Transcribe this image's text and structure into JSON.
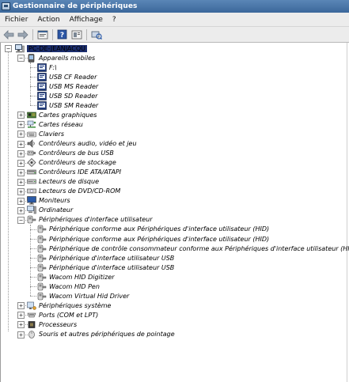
{
  "window": {
    "title": "Gestionnaire de périphériques"
  },
  "menu": [
    "Fichier",
    "Action",
    "Affichage",
    "?"
  ],
  "toolbar": [
    "back-arrow-icon",
    "forward-arrow-icon",
    "properties-icon",
    "help-icon",
    "console-icon",
    "scan-hardware-icon"
  ],
  "tree": {
    "root": "PC-DE-JEANJACQU",
    "categories": [
      {
        "label": "Appareils mobiles",
        "icon": "mobile-device-icon",
        "expanded": true,
        "children": [
          {
            "label": "F:\\",
            "icon": "drive-icon"
          },
          {
            "label": "USB CF Reader",
            "icon": "drive-icon"
          },
          {
            "label": "USB MS Reader",
            "icon": "drive-icon"
          },
          {
            "label": "USB SD Reader",
            "icon": "drive-icon"
          },
          {
            "label": "USB SM Reader",
            "icon": "drive-icon"
          }
        ]
      },
      {
        "label": "Cartes graphiques",
        "icon": "display-adapter-icon"
      },
      {
        "label": "Cartes réseau",
        "icon": "network-adapter-icon"
      },
      {
        "label": "Claviers",
        "icon": "keyboard-icon"
      },
      {
        "label": "Contrôleurs audio, vidéo et jeu",
        "icon": "speaker-icon"
      },
      {
        "label": "Contrôleurs de bus USB",
        "icon": "usb-icon"
      },
      {
        "label": "Contrôleurs de stockage",
        "icon": "storage-controller-icon"
      },
      {
        "label": "Contrôleurs IDE ATA/ATAPI",
        "icon": "ide-icon"
      },
      {
        "label": "Lecteurs de disque",
        "icon": "disk-drive-icon"
      },
      {
        "label": "Lecteurs de DVD/CD-ROM",
        "icon": "dvd-icon"
      },
      {
        "label": "Moniteurs",
        "icon": "monitor-icon"
      },
      {
        "label": "Ordinateur",
        "icon": "computer-icon"
      },
      {
        "label": "Périphériques d'interface utilisateur",
        "icon": "hid-icon",
        "expanded": true,
        "children": [
          {
            "label": "Périphérique conforme aux Périphériques d'interface utilisateur (HID)",
            "icon": "hid-icon"
          },
          {
            "label": "Périphérique conforme aux Périphériques d'interface utilisateur (HID)",
            "icon": "hid-icon"
          },
          {
            "label": "Périphérique de contrôle consommateur conforme aux Périphériques d'interface utilisateur (HID)",
            "icon": "hid-icon"
          },
          {
            "label": "Périphérique d'interface utilisateur USB",
            "icon": "hid-icon"
          },
          {
            "label": "Périphérique d'interface utilisateur USB",
            "icon": "hid-icon"
          },
          {
            "label": "Wacom HID Digitizer",
            "icon": "hid-icon"
          },
          {
            "label": "Wacom HID Pen",
            "icon": "hid-icon"
          },
          {
            "label": "Wacom Virtual Hid Driver",
            "icon": "hid-icon"
          }
        ]
      },
      {
        "label": "Périphériques système",
        "icon": "system-device-icon"
      },
      {
        "label": "Ports (COM et LPT)",
        "icon": "port-icon"
      },
      {
        "label": "Processeurs",
        "icon": "processor-icon"
      },
      {
        "label": "Souris et autres périphériques de pointage",
        "icon": "mouse-icon"
      }
    ]
  },
  "colors": {
    "titlebar": "#3b679b",
    "selection": "#1b2d6d"
  }
}
